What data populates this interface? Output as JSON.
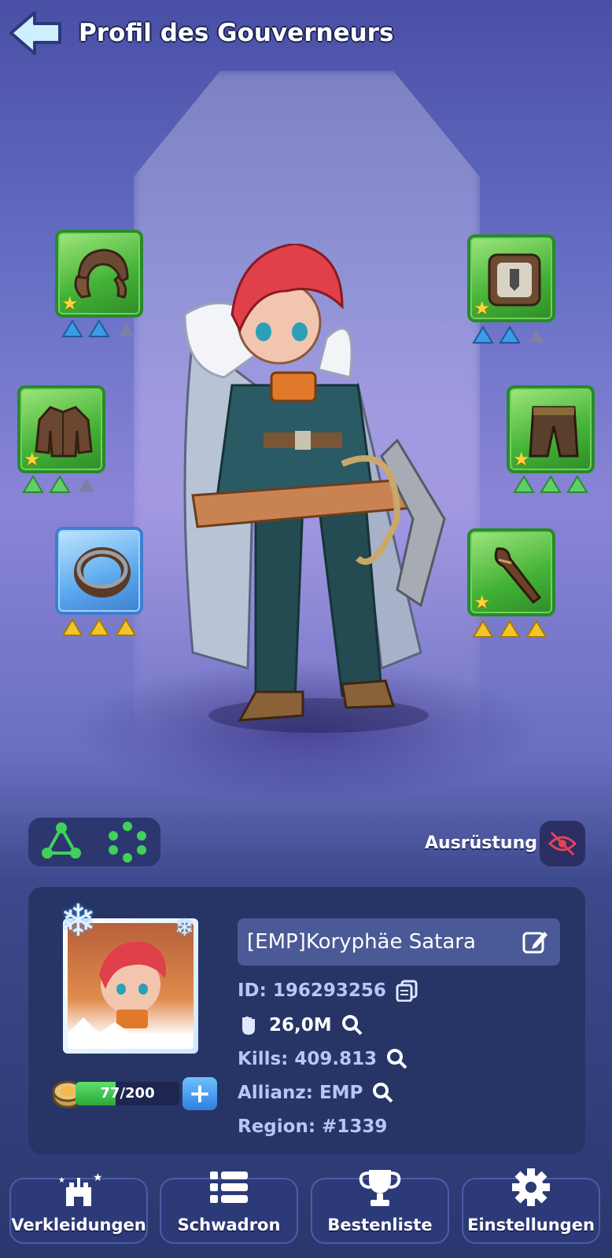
{
  "header": {
    "back_icon": "arrow-left-icon",
    "title": "Profil des Gouverneurs"
  },
  "equipment": {
    "slots": [
      {
        "slot": "helmet",
        "icon": "helmet-icon",
        "rarity": "green",
        "stars": 1,
        "tier_icons": [
          "blue",
          "blue",
          "gray"
        ]
      },
      {
        "slot": "chest",
        "icon": "jacket-icon",
        "rarity": "green",
        "stars": 1,
        "tier_icons": [
          "green",
          "green",
          "gray"
        ]
      },
      {
        "slot": "ring",
        "icon": "ring-icon",
        "rarity": "blue",
        "stars": 0,
        "tier_icons": [
          "yellow",
          "yellow",
          "yellow"
        ]
      },
      {
        "slot": "accessory",
        "icon": "shield-badge-icon",
        "rarity": "green",
        "stars": 1,
        "tier_icons": [
          "blue",
          "blue",
          "gray"
        ]
      },
      {
        "slot": "legs",
        "icon": "pants-icon",
        "rarity": "green",
        "stars": 1,
        "tier_icons": [
          "green",
          "green",
          "green"
        ]
      },
      {
        "slot": "weapon",
        "icon": "club-icon",
        "rarity": "green",
        "stars": 1,
        "tier_icons": [
          "yellow",
          "yellow",
          "yellow"
        ]
      }
    ]
  },
  "controls": {
    "equipment_label": "Ausrüstung",
    "eye_icon": "eye-hidden-icon",
    "toggle_icons": [
      "triangle-nodes-icon",
      "circle-nodes-icon"
    ]
  },
  "profile": {
    "name": "[EMP]Koryphäe Satara",
    "id_label": "ID: 196293256",
    "power_value": "26,0M",
    "kills_label": "Kills: 409.813",
    "alliance_label": "Allianz: EMP",
    "region_label": "Region: #1339",
    "xp_text": "77/200",
    "xp_progress": 0.385
  },
  "nav": {
    "buttons": [
      {
        "label": "Verkleidungen",
        "icon": "castle-icon"
      },
      {
        "label": "Schwadron",
        "icon": "list-icon"
      },
      {
        "label": "Bestenliste",
        "icon": "trophy-icon"
      },
      {
        "label": "Einstellungen",
        "icon": "gear-icon"
      }
    ]
  },
  "colors": {
    "rarity_green": "#42b135",
    "rarity_blue": "#5aa8ee",
    "panel_bg": "#263566",
    "xp_fill": "#2aa83a"
  }
}
